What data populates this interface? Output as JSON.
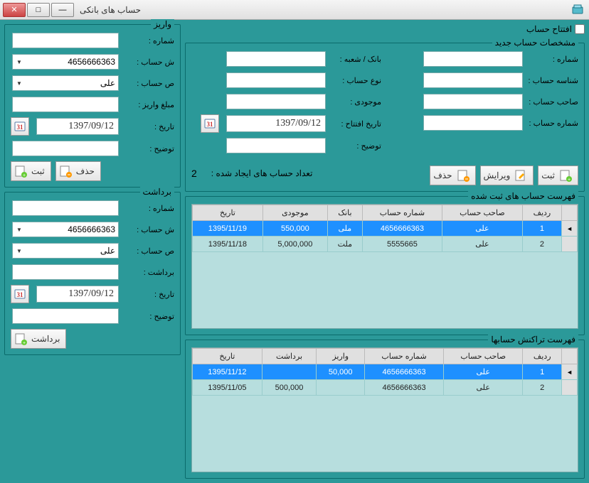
{
  "window": {
    "title": "حساب های بانکی"
  },
  "open_account": {
    "checkbox_label": "افتتاح حساب"
  },
  "new_account": {
    "group_title": "مشخصات حساب جدید",
    "labels": {
      "number": "شماره :",
      "account_id": "شناسه حساب :",
      "owner": "صاحب حساب :",
      "account_no": "شماره حساب :",
      "bank_branch": "بانک / شعبه :",
      "account_type": "نوع حساب :",
      "balance": "موجودی :",
      "open_date": "تاریخ افتتاح :",
      "desc": "توضیح :",
      "created_count": "تعداد حساب های ایجاد شده :"
    },
    "values": {
      "open_date": "1397/09/12",
      "created_count": "2"
    },
    "buttons": {
      "save": "ثبت",
      "edit": "ویرایش",
      "delete": "حذف"
    }
  },
  "accounts_list": {
    "group_title": "فهرست حساب های ثبت شده",
    "headers": {
      "row": "ردیف",
      "owner": "صاحب حساب",
      "account_no": "شماره حساب",
      "bank": "بانک",
      "balance": "موجودی",
      "date": "تاریخ"
    },
    "rows": [
      {
        "row": "1",
        "owner": "علی",
        "account_no": "4656666363",
        "bank": "ملی",
        "balance": "550,000",
        "date": "1395/11/19",
        "selected": true
      },
      {
        "row": "2",
        "owner": "علی",
        "account_no": "5555665",
        "bank": "ملت",
        "balance": "5,000,000",
        "date": "1395/11/18",
        "selected": false
      }
    ]
  },
  "deposit": {
    "group_title": "واریز",
    "labels": {
      "number": "شماره :",
      "account_no": "ش حساب :",
      "owner": "ص حساب :",
      "amount": "مبلغ واریز :",
      "date": "تاریخ :",
      "desc": "توضیح :"
    },
    "values": {
      "account_no": "4656666363",
      "owner": "علی",
      "date": "1397/09/12"
    },
    "buttons": {
      "save": "ثبت",
      "delete": "حذف"
    }
  },
  "withdraw": {
    "group_title": "برداشت",
    "labels": {
      "number": "شماره :",
      "account_no": "ش حساب :",
      "owner": "ص حساب :",
      "amount": "برداشت :",
      "date": "تاریخ :",
      "desc": "توضیح :"
    },
    "values": {
      "account_no": "4656666363",
      "owner": "علی",
      "date": "1397/09/12"
    },
    "buttons": {
      "withdraw": "برداشت"
    }
  },
  "transactions": {
    "group_title": "فهرست تراکنش حسابها",
    "headers": {
      "row": "ردیف",
      "owner": "صاحب حساب",
      "account_no": "شماره حساب",
      "deposit": "واریز",
      "withdraw": "برداشت",
      "date": "تاریخ"
    },
    "rows": [
      {
        "row": "1",
        "owner": "علی",
        "account_no": "4656666363",
        "deposit": "50,000",
        "withdraw": "",
        "date": "1395/11/12",
        "selected": true
      },
      {
        "row": "2",
        "owner": "علی",
        "account_no": "4656666363",
        "deposit": "",
        "withdraw": "500,000",
        "date": "1395/11/05",
        "selected": false
      }
    ]
  }
}
